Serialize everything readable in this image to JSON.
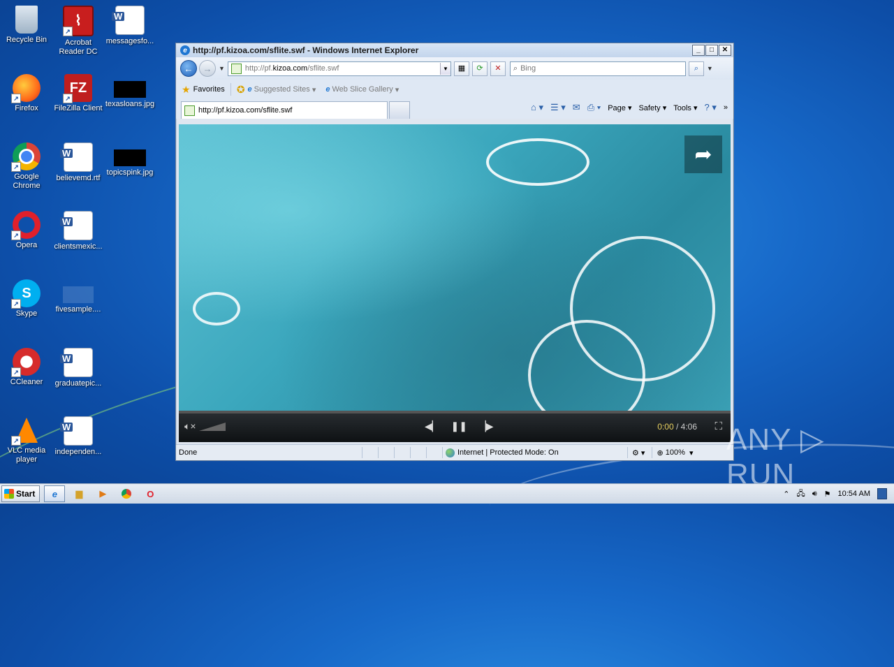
{
  "desktop": {
    "icons": [
      {
        "label": "Recycle Bin"
      },
      {
        "label": "Acrobat Reader DC"
      },
      {
        "label": "messagesfo..."
      },
      {
        "label": "Firefox"
      },
      {
        "label": "FileZilla Client"
      },
      {
        "label": "texasloans.jpg"
      },
      {
        "label": "Google Chrome"
      },
      {
        "label": "believemd.rtf"
      },
      {
        "label": "topicspink.jpg"
      },
      {
        "label": "Opera"
      },
      {
        "label": "clientsmexic..."
      },
      {
        "label": "Skype"
      },
      {
        "label": "fivesample...."
      },
      {
        "label": "CCleaner"
      },
      {
        "label": "graduatepic..."
      },
      {
        "label": "VLC media player"
      },
      {
        "label": "independen..."
      }
    ]
  },
  "ie": {
    "title": "http://pf.kizoa.com/sflite.swf - Windows Internet Explorer",
    "address_prefix": "http://pf.",
    "address_host": "kizoa.com",
    "address_suffix": "/sflite.swf",
    "search_placeholder": "Bing",
    "favorites_label": "Favorites",
    "suggested_sites": "Suggested Sites",
    "web_slice_gallery": "Web Slice Gallery",
    "tab_title": "http://pf.kizoa.com/sflite.swf",
    "cmd_page": "Page",
    "cmd_safety": "Safety",
    "cmd_tools": "Tools",
    "status_done": "Done",
    "status_zone": "Internet | Protected Mode: On",
    "status_zoom": "100%"
  },
  "player": {
    "time_current": "0:00",
    "time_sep": " / ",
    "time_total": "4:06",
    "progress": 0
  },
  "watermark": "ANY ▷ RUN",
  "taskbar": {
    "start_label": "Start",
    "clock": "10:54 AM"
  }
}
